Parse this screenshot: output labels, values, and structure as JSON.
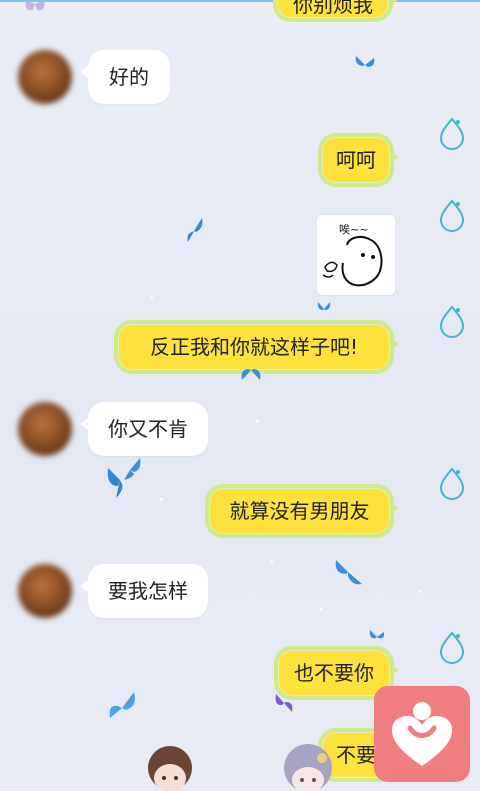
{
  "messages": {
    "m0": "你别烦我",
    "m1": "好的",
    "m2": "呵呵",
    "m3_sticker_caption": "唉~~",
    "m4": "反正我和你就这样子吧!",
    "m5": "你又不肯",
    "m6": "就算没有男朋友",
    "m7": "要我怎样",
    "m8": "也不要你",
    "m9": "不要"
  },
  "colors": {
    "outgoing_bubble": "#ffe13d",
    "outgoing_border": "#cfe98c",
    "incoming_bubble": "#ffffff",
    "float_button": "#f07d80",
    "background": "#e7ebf4"
  },
  "icons": {
    "read_receipt": "water-drop-icon",
    "decoration": "blue-butterfly-icon",
    "float_button": "heart-person-icon"
  }
}
